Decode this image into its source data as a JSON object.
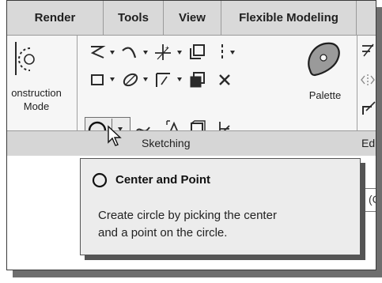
{
  "tabs": [
    "Render",
    "Tools",
    "View",
    "Flexible Modeling"
  ],
  "ribbon": {
    "construction_label_line1": "onstruction",
    "construction_label_line2": "Mode",
    "palette_label": "Palette",
    "sketching_group_label": "Sketching",
    "next_group_label": "Ed"
  },
  "tooltip": {
    "title": "Center and Point",
    "description_line1": "Create circle by picking the center",
    "description_line2": "and a point on the circle."
  },
  "side_input": {
    "glyph": "(C"
  },
  "colors": {
    "tab_bar": "#d9d9d9",
    "ribbon": "#f6f6f6",
    "group_bar": "#d6d6d6",
    "tooltip": "#ececec"
  }
}
